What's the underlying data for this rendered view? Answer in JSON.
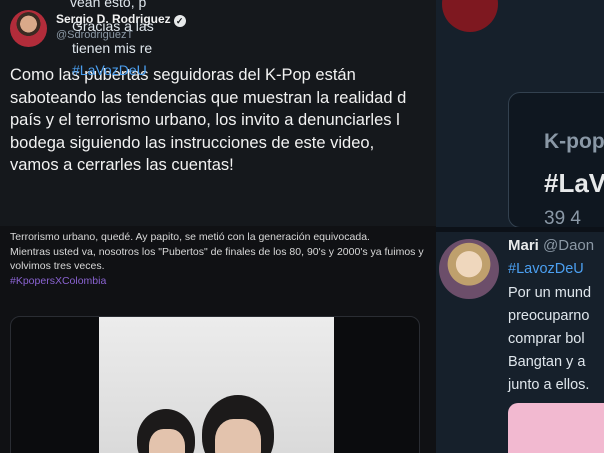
{
  "main_tweet": {
    "author_name": "Sergio D. Rodriguez",
    "author_handle": "@SdrodriguezT",
    "verified_glyph": "✓",
    "text": "Como las pubertas seguidoras del K-Pop están\nsaboteando las tendencias que muestran la realidad d\npaís y el terrorismo urbano, los invito a denunciarles l\nbodega siguiendo las instrucciones de este video,\nvamos a cerrarles las cuentas!"
  },
  "embedded_post": {
    "line1": "Terrorismo urbano, quedé. Ay papito, se metió con la generación equivocada.",
    "line2": "Mientras usted va, nosotros los \"Pubertos\" de finales de los 80, 90's y 2000's ya fuimos y volvimos tres veces.",
    "hashtag": "#KpopersXColombia"
  },
  "right_top": {
    "line0": "vean esto, p",
    "line1": "Gracias a las",
    "line2": "tienen mis re",
    "hashtag": "#LaVozDeU",
    "card_brand": "K-pop",
    "card_tag": "#LaV",
    "card_count": "39 4"
  },
  "mari_tweet": {
    "name": "Mari",
    "handle": "@Daon",
    "hashtag": "#LavozDeU",
    "lines": [
      "Por un mund",
      "preocuparno",
      "comprar bol",
      "Bangtan y a",
      "junto a ellos."
    ]
  },
  "colors": {
    "hashtag_purple": "#8a63d2",
    "hashtag_blue": "#4b9ff0",
    "right_panel_bg": "#16202b"
  },
  "icons": [
    "verified-icon"
  ]
}
